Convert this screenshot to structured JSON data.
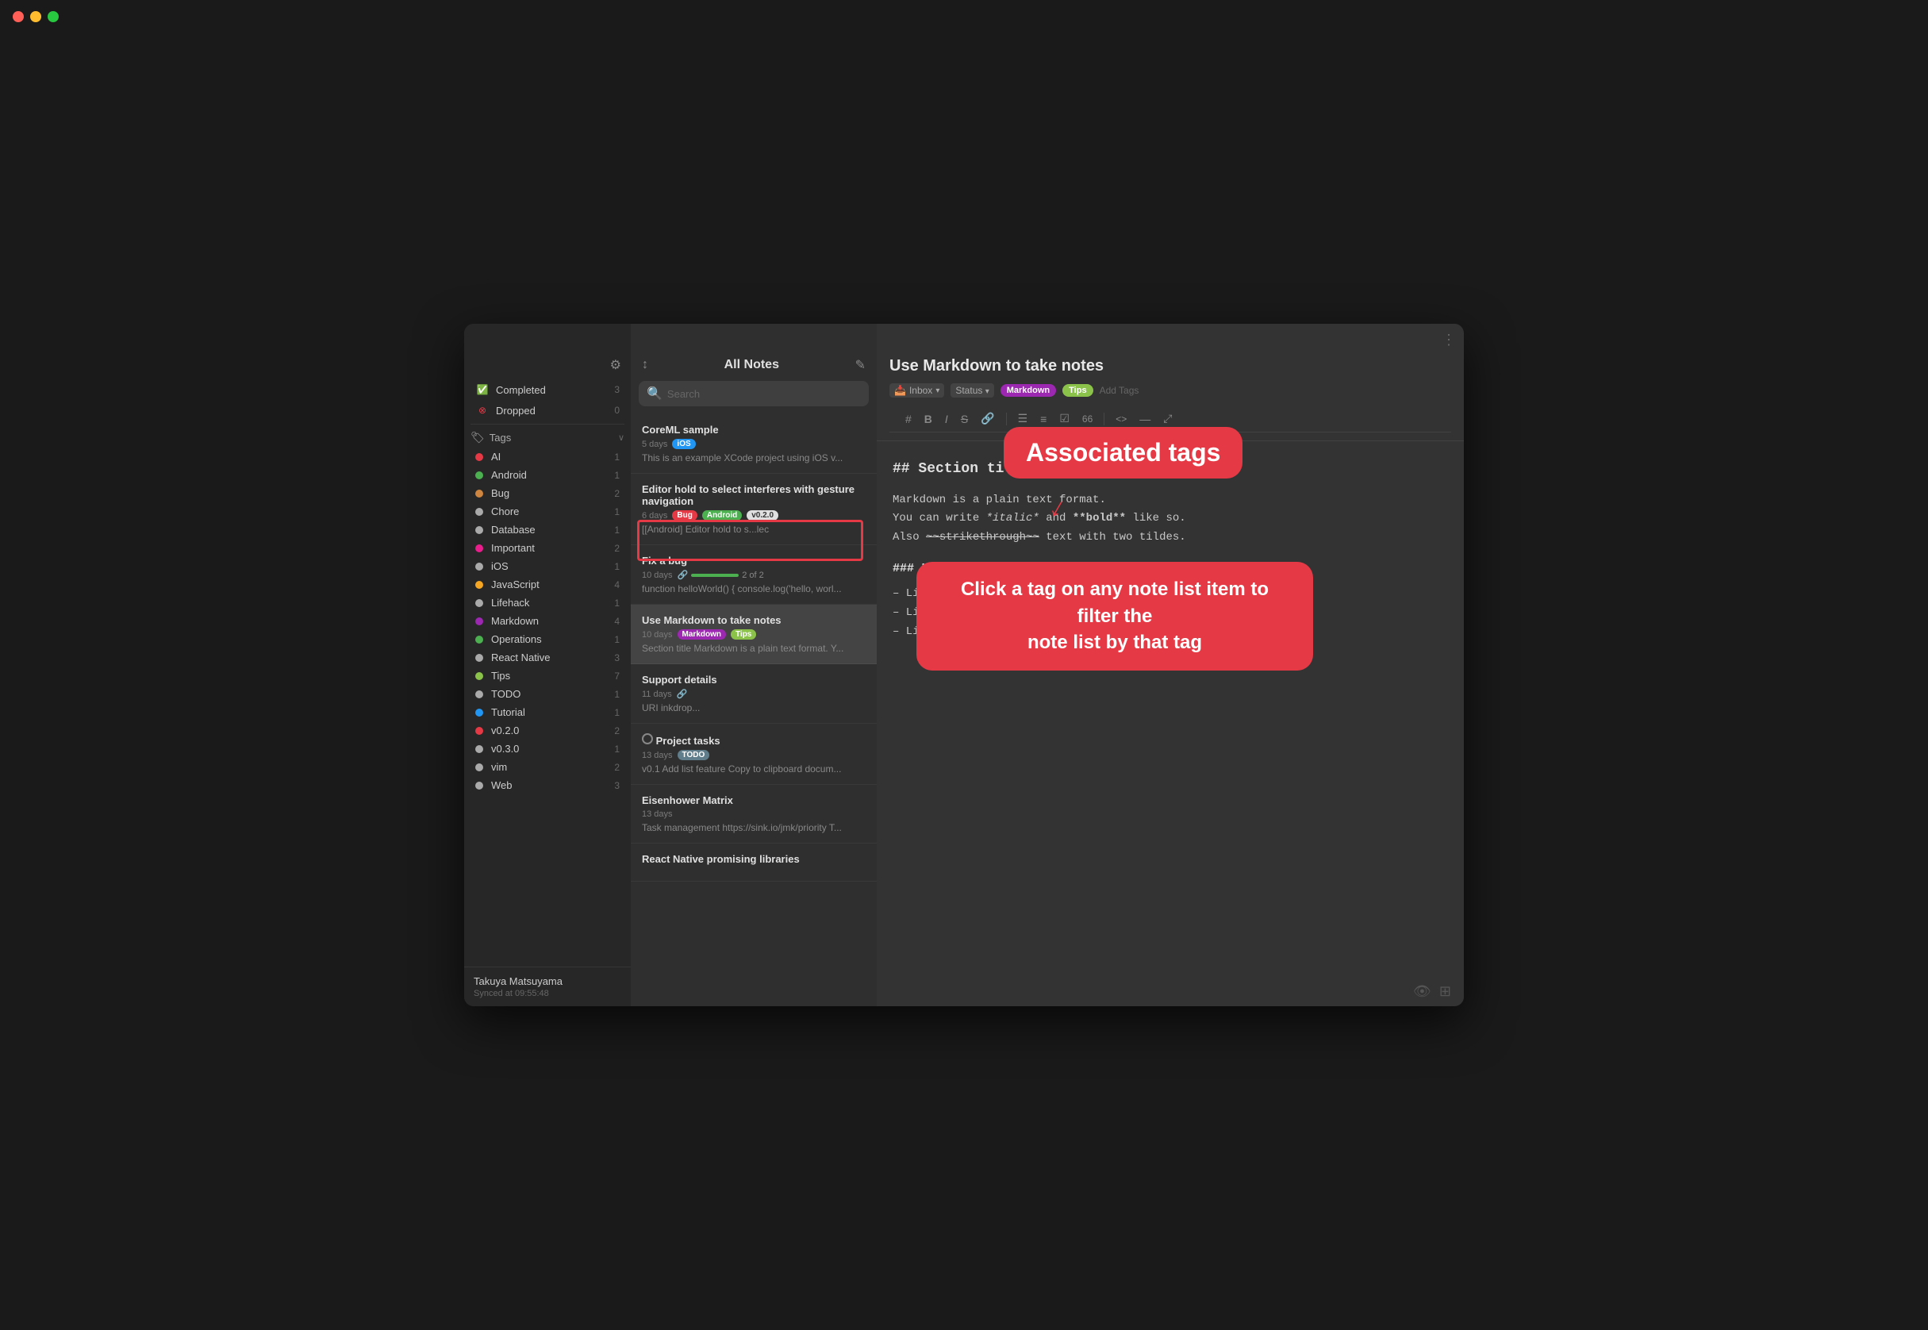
{
  "window": {
    "title": "All Notes"
  },
  "sidebar": {
    "gear_icon": "⚙",
    "status_items": [
      {
        "label": "Completed",
        "icon": "✅",
        "icon_color": "#28c840",
        "count": "3",
        "type": "status-completed"
      },
      {
        "label": "Dropped",
        "icon": "⊗",
        "icon_color": "#e63946",
        "count": "0",
        "type": "status-dropped"
      }
    ],
    "tags_label": "Tags",
    "tags_chevron": "∨",
    "tags": [
      {
        "label": "AI",
        "color": "#e63946",
        "count": "1"
      },
      {
        "label": "Android",
        "color": "#4caf50",
        "count": "1"
      },
      {
        "label": "Bug",
        "color": "#cd853f",
        "count": "2"
      },
      {
        "label": "Chore",
        "color": "#aaaaaa",
        "count": "1"
      },
      {
        "label": "Database",
        "color": "#aaaaaa",
        "count": "1"
      },
      {
        "label": "Important",
        "color": "#e91e8c",
        "count": "2"
      },
      {
        "label": "iOS",
        "color": "#aaaaaa",
        "count": "1"
      },
      {
        "label": "JavaScript",
        "color": "#f5a623",
        "count": "4"
      },
      {
        "label": "Lifehack",
        "color": "#aaaaaa",
        "count": "1"
      },
      {
        "label": "Markdown",
        "color": "#9c27b0",
        "count": "4"
      },
      {
        "label": "Operations",
        "color": "#4caf50",
        "count": "1"
      },
      {
        "label": "React Native",
        "color": "#aaaaaa",
        "count": "3"
      },
      {
        "label": "Tips",
        "color": "#8bc34a",
        "count": "7"
      },
      {
        "label": "TODO",
        "color": "#aaaaaa",
        "count": "1"
      },
      {
        "label": "Tutorial",
        "color": "#2196f3",
        "count": "1"
      },
      {
        "label": "v0.2.0",
        "color": "#e63946",
        "count": "2"
      },
      {
        "label": "v0.3.0",
        "color": "#aaaaaa",
        "count": "1"
      },
      {
        "label": "vim",
        "color": "#aaaaaa",
        "count": "2"
      },
      {
        "label": "Web",
        "color": "#aaaaaa",
        "count": "3"
      }
    ],
    "user": {
      "name": "Takuya Matsuyama",
      "sync": "Synced at 09:55:48"
    }
  },
  "note_list": {
    "title": "All Notes",
    "sort_icon": "↕",
    "compose_icon": "✎",
    "search_placeholder": "Search",
    "notes": [
      {
        "id": "coreml",
        "title": "CoreML sample",
        "date": "5 days",
        "tags": [
          {
            "label": "iOS",
            "bg": "#2196f3",
            "color": "#fff"
          }
        ],
        "preview": "This is an example XCode project using iOS v...",
        "active": false
      },
      {
        "id": "editor-hold",
        "title": "Editor hold to select interferes with gesture navigation",
        "date": "6 days",
        "tags": [
          {
            "label": "Bug",
            "bg": "#e63946",
            "color": "#fff"
          },
          {
            "label": "Android",
            "bg": "#4caf50",
            "color": "#fff"
          },
          {
            "label": "v0.2.0",
            "bg": "#e0e0e0",
            "color": "#333"
          }
        ],
        "preview": "[[Android] Editor hold to s...lec",
        "active": false,
        "has_red_box": true
      },
      {
        "id": "fix-bug",
        "title": "Fix a bug",
        "date": "10 days",
        "progress": true,
        "progress_val": 100,
        "progress_label": "2 of 2",
        "preview": "function helloWorld() { console.log('hello, worl...",
        "active": false
      },
      {
        "id": "use-markdown",
        "title": "Use Markdown to take notes",
        "date": "10 days",
        "tags": [
          {
            "label": "Markdown",
            "bg": "#9c27b0",
            "color": "#fff"
          },
          {
            "label": "Tips",
            "bg": "#8bc34a",
            "color": "#fff"
          }
        ],
        "preview": "Section title Markdown is a plain text format. Y...",
        "active": true
      },
      {
        "id": "support-details",
        "title": "Support details",
        "date": "11 days",
        "tags": [],
        "preview": "URI inkdrop...",
        "active": false,
        "has_progress_icon": true
      },
      {
        "id": "project-tasks",
        "title": "Project tasks",
        "date": "13 days",
        "tags": [
          {
            "label": "TODO",
            "bg": "#607d8b",
            "color": "#fff"
          }
        ],
        "preview": "v0.1 Add list feature Copy to clipboard docum...",
        "active": false,
        "is_task": true
      },
      {
        "id": "eisenhower",
        "title": "Eisenhower Matrix",
        "date": "13 days",
        "tags": [],
        "preview": "Task management https://sink.io/jmk/priority T...",
        "active": false
      },
      {
        "id": "react-native",
        "title": "React Native promising libraries",
        "date": "",
        "tags": [],
        "preview": "",
        "active": false
      }
    ]
  },
  "editor": {
    "title": "Use Markdown to take notes",
    "inbox_label": "Inbox",
    "status_label": "Status",
    "tags": [
      {
        "label": "Markdown",
        "bg": "#9c27b0",
        "color": "#fff"
      },
      {
        "label": "Tips",
        "bg": "#8bc34a",
        "color": "#fff"
      }
    ],
    "add_tags_label": "Add Tags",
    "toolbar": {
      "hash": "#",
      "bold": "B",
      "italic": "I",
      "strike": "S",
      "link": "🔗",
      "list_ul": "☰",
      "list_ol": "≡",
      "check": "☑",
      "num": "66",
      "code": "<>",
      "hr": "—",
      "expand": "⤢"
    },
    "content": {
      "h2": "## Section title",
      "para1": "Markdown is a plain text format.",
      "para2_prefix": "You can write ",
      "italic": "*italic*",
      "para2_mid": " and ",
      "bold": "**bold**",
      "para2_suffix": " like so.",
      "para3_prefix": "Also ",
      "strike": "~~strikethrough~~",
      "para3_suffix": " text with two tildes.",
      "h3": "### List example",
      "list": [
        "– List item 1",
        "– List item 2",
        "– List item 3"
      ]
    }
  },
  "tooltips": {
    "associated_tags": "Associated tags",
    "filter_hint": "Click a tag on any note list item to filter the\nnote list by that tag"
  }
}
